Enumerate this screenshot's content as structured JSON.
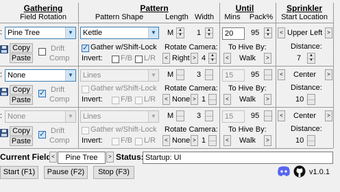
{
  "headers": {
    "gathering": "Gathering",
    "field_rotation": "Field Rotation",
    "pattern": "Pattern",
    "pattern_shape": "Pattern Shape",
    "length": "Length",
    "width": "Width",
    "until": "Until",
    "mins": "Mins",
    "pack": "Pack%",
    "sprinkler": "Sprinkler",
    "start_location": "Start Location"
  },
  "rows": [
    {
      "field_prefix": ":",
      "field": "Pine Tree",
      "copy": "Copy",
      "paste": "Paste",
      "drift1": "Drift",
      "drift2": "Comp",
      "pattern": "Kettle",
      "gather_shift": "Gather w/Shift-Lock",
      "invert": "Invert:",
      "fb": "F/B",
      "lr": "L/R",
      "length": "M",
      "width": "1",
      "rotate_camera": "Rotate Camera:",
      "rot_dir": "Right",
      "rot_num": "4",
      "mins": "20",
      "pack": "95",
      "to_hive_by": "To Hive By:",
      "hive_method": "Walk",
      "start_loc": "Upper Left",
      "distance_label": "Distance:",
      "distance": "7"
    },
    {
      "field_prefix": ":",
      "field": "None",
      "copy": "Copy",
      "paste": "Paste",
      "drift1": "Drift",
      "drift2": "Comp",
      "pattern": "Lines",
      "gather_shift": "Gather w/Shift-Lock",
      "invert": "Invert:",
      "fb": "F/B",
      "lr": "L/R",
      "length": "M",
      "width": "3",
      "rotate_camera": "Rotate Camera:",
      "rot_dir": "None",
      "rot_num": "1",
      "mins": "15",
      "pack": "95",
      "to_hive_by": "To Hive By:",
      "hive_method": "Walk",
      "start_loc": "Center",
      "distance_label": "Distance:",
      "distance": "10"
    },
    {
      "field_prefix": ":",
      "field": "None",
      "copy": "Copy",
      "paste": "Paste",
      "drift1": "Drift",
      "drift2": "Comp",
      "pattern": "Lines",
      "gather_shift": "Gather w/Shift-Lock",
      "invert": "Invert:",
      "fb": "F/B",
      "lr": "L/R",
      "length": "M",
      "width": "3",
      "rotate_camera": "Rotate Camera:",
      "rot_dir": "None",
      "rot_num": "1",
      "mins": "15",
      "pack": "95",
      "to_hive_by": "To Hive By:",
      "hive_method": "Walk",
      "start_loc": "Center",
      "distance_label": "Distance:",
      "distance": "10"
    }
  ],
  "footer": {
    "current_field_label": "Current Field:",
    "current_field": "Pine Tree",
    "status_label": "Status:",
    "status": "Startup: UI",
    "start": "Start (F1)",
    "pause": "Pause (F2)",
    "stop": "Stop (F3)",
    "version": "v1.0.1"
  },
  "colors": {
    "discord": "#5865f2",
    "github": "#111111"
  }
}
